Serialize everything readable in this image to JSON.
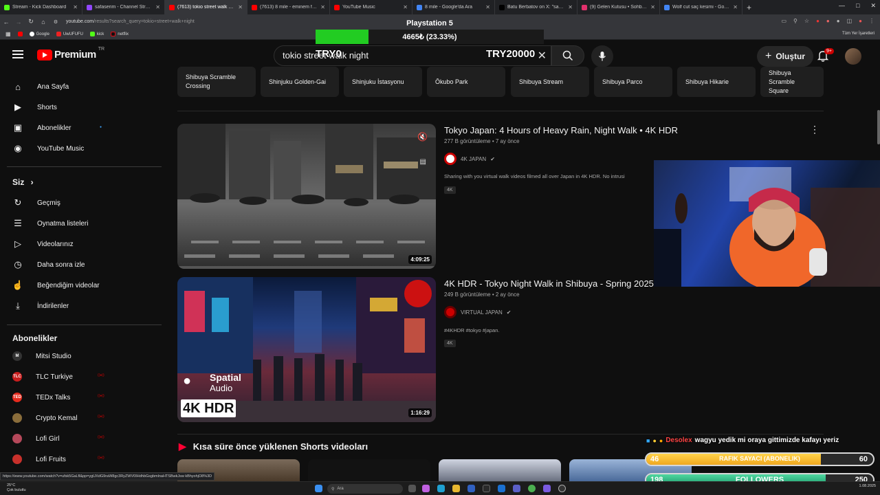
{
  "browser": {
    "tabs": [
      {
        "label": "Stream - Kick Dashboard",
        "color": "#53fc18"
      },
      {
        "label": "safaserim - Channel Streams on",
        "color": "#9147ff"
      },
      {
        "label": "(7613) tokio street walk night",
        "color": "#ff0000"
      },
      {
        "label": "(7613) 8 mile - eminem final ra",
        "color": "#ff0000"
      },
      {
        "label": "YouTube Music",
        "color": "#ff0000"
      },
      {
        "label": "8 mile - Google'da Ara",
        "color": "#4285f4"
      },
      {
        "label": "Batu Berbatov on X: \"sabaha k",
        "color": "#000000"
      },
      {
        "label": "(9) Gelen Kutusu • Sohbetler",
        "color": "#e1306c"
      },
      {
        "label": "Wolf cut saç kesimi - Google'd",
        "color": "#4285f4"
      }
    ],
    "active_tab_index": 2,
    "url_host": "youtube.com",
    "url_path": "/results?search_query=tokio+street+walk+night",
    "bookmarks": [
      "Google",
      "UwUFUFU",
      "kick",
      "netflix"
    ],
    "bookmarks_right": "Tüm Yer İşaretleri",
    "status_url": "https://www.youtube.com/watch?v=ufsk5GaLfl&pp=ygUXdG9raW8gc3RyZWV0IHdhbGsgbmlnaHTSBwkJsw kBhyohjO8%3D"
  },
  "header": {
    "logo_text": "Premium",
    "logo_region": "TR",
    "search_value": "tokio street walk night",
    "create_label": "Oluştur",
    "notif_badge": "9+"
  },
  "overlay": {
    "title": "Playstation 5",
    "progress_text": "4665₺ (23.33%)",
    "progress_percent": 23.33,
    "left_label": "TRY0",
    "right_label": "TRY20000"
  },
  "sidebar": {
    "main": [
      {
        "label": "Ana Sayfa",
        "icon": "home-icon"
      },
      {
        "label": "Shorts",
        "icon": "shorts-icon"
      },
      {
        "label": "Abonelikler",
        "icon": "subscriptions-icon"
      },
      {
        "label": "YouTube Music",
        "icon": "youtube-music-icon"
      }
    ],
    "you_head": "Siz",
    "you": [
      {
        "label": "Geçmiş",
        "icon": "history-icon"
      },
      {
        "label": "Oynatma listeleri",
        "icon": "playlists-icon"
      },
      {
        "label": "Videolarınız",
        "icon": "your-videos-icon"
      },
      {
        "label": "Daha sonra izle",
        "icon": "watch-later-icon"
      },
      {
        "label": "Beğendiğim videolar",
        "icon": "liked-videos-icon"
      },
      {
        "label": "İndirilenler",
        "icon": "downloads-icon"
      }
    ],
    "subs_head": "Abonelikler",
    "subs": [
      {
        "label": "Mitsi Studio",
        "initial": "M",
        "color": "#333333"
      },
      {
        "label": "TLC Turkiye",
        "initial": "TLC",
        "color": "#c81e1e"
      },
      {
        "label": "TEDx Talks",
        "initial": "TED",
        "color": "#e62b1e"
      },
      {
        "label": "Crypto Kemal",
        "initial": "",
        "color": "#8a6d3b"
      },
      {
        "label": "Lofi Girl",
        "initial": "",
        "color": "#b5485a"
      },
      {
        "label": "Lofi Fruits",
        "initial": "",
        "color": "#c7302b"
      }
    ]
  },
  "chips": [
    "Shibuya Scramble Crossing",
    "Shinjuku Golden-Gai",
    "Shinjuku İstasyonu",
    "Ōkubo Park",
    "Shibuya Stream",
    "Shibuya Parco",
    "Shibuya Hikarie",
    "Shibuya Scramble Square"
  ],
  "videos": [
    {
      "title": "Tokyo Japan: 4 Hours of Heavy Rain, Night Walk • 4K HDR",
      "meta": "277 B görüntüleme • 7 ay önce",
      "channel": "4K JAPAN",
      "desc": "Sharing with you virtual walk videos filmed all over Japan in 4K HDR. No intrusi",
      "badge": "4K",
      "duration": "4:09:25"
    },
    {
      "title": "4K HDR - Tokyo Night Walk in Shibuya - Spring 2025",
      "meta": "249 B görüntüleme • 2 ay önce",
      "channel": "VIRTUAL JAPAN",
      "desc": "#4KHDR #tokyo #japan.",
      "badge": "4K",
      "duration": "1:16:29",
      "thumb_text1": "Spatial",
      "thumb_text2": "Audio",
      "thumb_text3": "4K HDR"
    }
  ],
  "shorts_head": "Kısa süre önce yüklenen Shorts videoları",
  "stream": {
    "chat_user": "Desolex",
    "chat_msg": "wagyu yedik mi oraya gittimizde kafayı yeriz",
    "sub_left": "46",
    "sub_label": "RAFIK SAYACI (ABONELIK)",
    "sub_right": "60",
    "sub_fraction": 0.77,
    "fol_left": "198",
    "fol_label": "FOLLOWERS",
    "fol_right": "250",
    "fol_fraction": 0.79
  },
  "taskbar": {
    "weather_temp": "25°C",
    "weather_desc": "Çok bulutlu",
    "search_placeholder": "Ara",
    "date": "1.08.2025"
  }
}
